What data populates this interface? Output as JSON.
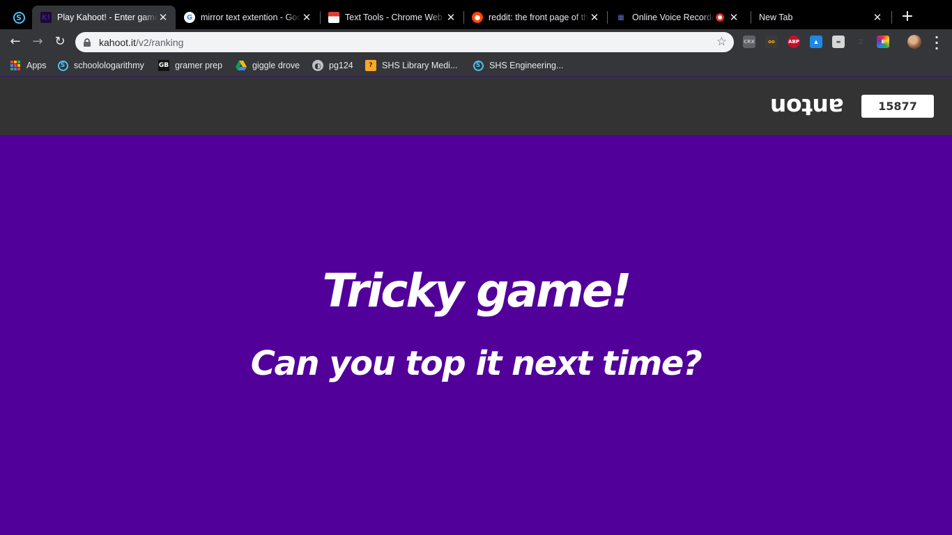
{
  "browser": {
    "tabs": [
      {
        "title": "Play Kahoot! - Enter game PIN here!",
        "active": true
      },
      {
        "title": "mirror text extention - Google Search",
        "active": false
      },
      {
        "title": "Text Tools - Chrome Web Store",
        "active": false
      },
      {
        "title": "reddit: the front page of the internet",
        "active": false
      },
      {
        "title": "Online Voice Recorder",
        "active": false
      },
      {
        "title": "New Tab",
        "active": false
      }
    ],
    "new_tab_symbol": "+",
    "address": {
      "host": "kahoot.it",
      "path": "/v2/ranking"
    },
    "bookmarks": [
      {
        "label": "Apps",
        "icon": "apps-grid-icon"
      },
      {
        "label": "schoolologarithmy",
        "icon": "schoology-icon"
      },
      {
        "label": "gramer prep",
        "icon": "gb-icon"
      },
      {
        "label": "giggle drove",
        "icon": "drive-icon"
      },
      {
        "label": "pg124",
        "icon": "globe-icon"
      },
      {
        "label": "SHS Library Medi...",
        "icon": "library-icon"
      },
      {
        "label": "SHS Engineering...",
        "icon": "schoology-icon"
      }
    ],
    "extensions": [
      {
        "name": "crx-icon",
        "text": "CRX",
        "color": "#5f6368"
      },
      {
        "name": "owl-icon",
        "text": "oo",
        "color": "#3b3b3b"
      },
      {
        "name": "abp-icon",
        "text": "ABP",
        "color": "#c70d2c"
      },
      {
        "name": "vector-icon",
        "text": "▲",
        "color": "#1e88e5"
      },
      {
        "name": "briefcase-icon",
        "text": "▬",
        "color": "#d6d6d6"
      },
      {
        "name": "z-icon",
        "text": "Z",
        "color": "#35363a"
      },
      {
        "name": "color-icon",
        "text": "E",
        "color": "#7cb342"
      }
    ]
  },
  "kahoot": {
    "nickname": "anton",
    "score": "15877",
    "headline": "Tricky game!",
    "subline": "Can you top it next time?",
    "colors": {
      "header_bg": "#333333",
      "main_bg": "#51009a"
    }
  }
}
